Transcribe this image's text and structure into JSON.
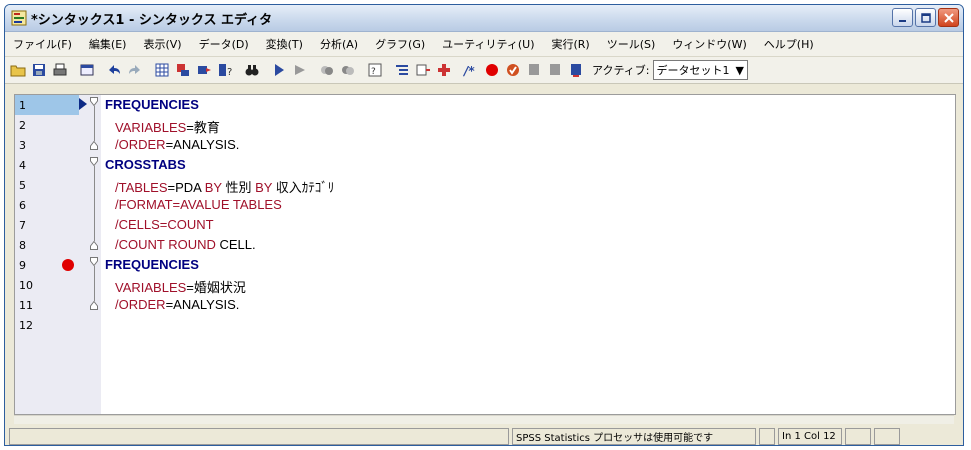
{
  "window": {
    "title": "*シンタックス1 - シンタックス エディタ",
    "app_icon": "syntax-editor-icon"
  },
  "menu": [
    {
      "label": "ファイル(F)"
    },
    {
      "label": "編集(E)"
    },
    {
      "label": "表示(V)"
    },
    {
      "label": "データ(D)"
    },
    {
      "label": "変換(T)"
    },
    {
      "label": "分析(A)"
    },
    {
      "label": "グラフ(G)"
    },
    {
      "label": "ユーティリティ(U)"
    },
    {
      "label": "実行(R)"
    },
    {
      "label": "ツール(S)"
    },
    {
      "label": "ウィンドウ(W)"
    },
    {
      "label": "ヘルプ(H)"
    }
  ],
  "toolbar": {
    "active_label": "アクティブ:",
    "dataset_value": "データセット1"
  },
  "editor": {
    "current_line": 1,
    "lines": [
      {
        "num": "1",
        "tokens": [
          {
            "t": "FREQUENCIES",
            "c": "kw"
          }
        ]
      },
      {
        "num": "2",
        "tokens": [
          {
            "t": "VARIABLES",
            "c": "sub"
          },
          {
            "t": "=教育",
            "c": "plain"
          }
        ]
      },
      {
        "num": "3",
        "tokens": [
          {
            "t": "/ORDER",
            "c": "sub"
          },
          {
            "t": "=ANALYSIS.",
            "c": "plain"
          }
        ]
      },
      {
        "num": "4",
        "tokens": [
          {
            "t": "CROSSTABS",
            "c": "kw"
          }
        ]
      },
      {
        "num": "5",
        "tokens": [
          {
            "t": "/TABLES",
            "c": "sub"
          },
          {
            "t": "=PDA ",
            "c": "plain"
          },
          {
            "t": "BY",
            "c": "sub"
          },
          {
            "t": " 性別 ",
            "c": "plain"
          },
          {
            "t": "BY",
            "c": "sub"
          },
          {
            "t": " 収入ｶﾃｺﾞﾘ",
            "c": "plain"
          }
        ]
      },
      {
        "num": "6",
        "tokens": [
          {
            "t": "/FORMAT=AVALUE TABLES",
            "c": "sub"
          }
        ]
      },
      {
        "num": "7",
        "tokens": [
          {
            "t": "/CELLS=COUNT",
            "c": "sub"
          }
        ]
      },
      {
        "num": "8",
        "tokens": [
          {
            "t": "/COUNT ROUND",
            "c": "sub"
          },
          {
            "t": " CELL.",
            "c": "plain"
          }
        ]
      },
      {
        "num": "9",
        "tokens": [
          {
            "t": "FREQUENCIES",
            "c": "kw"
          }
        ]
      },
      {
        "num": "10",
        "tokens": [
          {
            "t": "VARIABLES",
            "c": "sub"
          },
          {
            "t": "=婚姻状況",
            "c": "plain"
          }
        ]
      },
      {
        "num": "11",
        "tokens": [
          {
            "t": "/ORDER",
            "c": "sub"
          },
          {
            "t": "=ANALYSIS.",
            "c": "plain"
          }
        ]
      },
      {
        "num": "12",
        "tokens": []
      }
    ]
  },
  "status": {
    "processor": "SPSS Statistics プロセッサは使用可能です",
    "position": "In 1 Col 12"
  },
  "colors": {
    "keyword": "#000080",
    "subcommand": "#a0102a",
    "breakpoint": "#e00000",
    "current_line_bg": "#9ec6e8"
  }
}
